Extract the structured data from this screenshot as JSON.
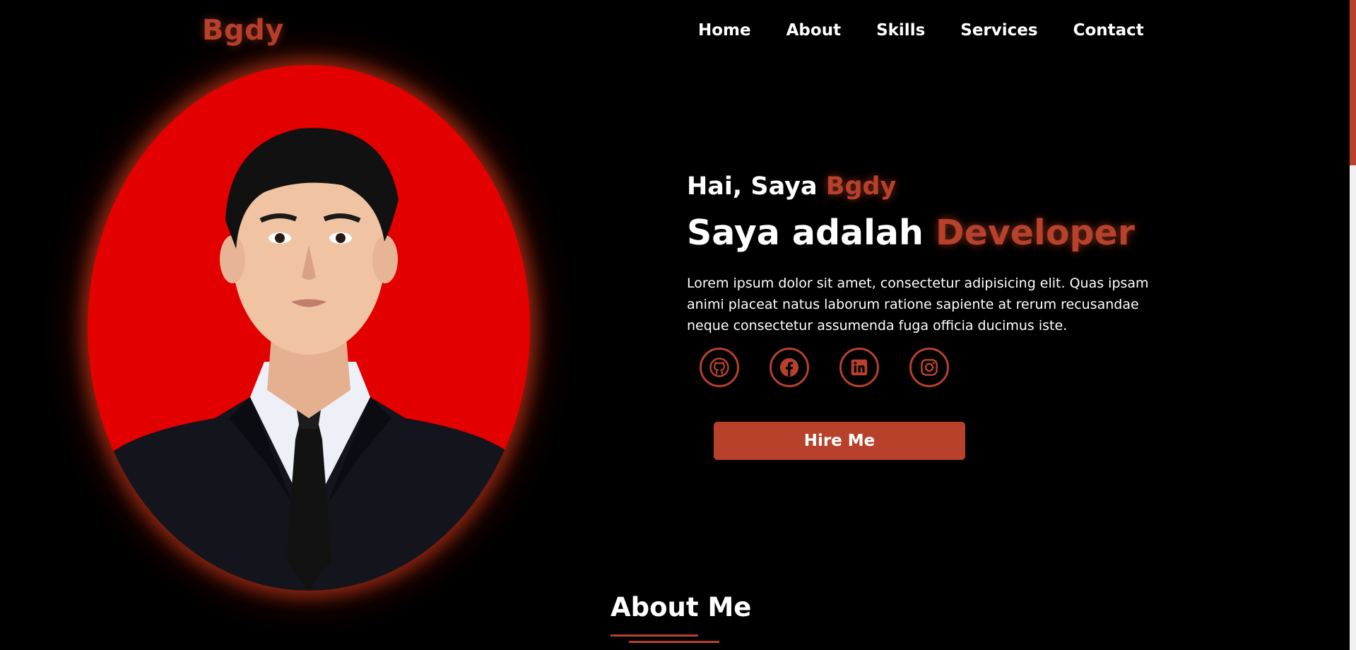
{
  "logo": "Bgdy",
  "nav": {
    "items": [
      "Home",
      "About",
      "Skills",
      "Services",
      "Contact"
    ]
  },
  "hero": {
    "greeting_prefix": "Hai, Saya ",
    "greeting_name": "Bgdy",
    "title_prefix": "Saya adalah ",
    "title_role": "Developer",
    "description": "Lorem ipsum dolor sit amet, consectetur adipisicing elit. Quas ipsam animi placeat natus laborum ratione sapiente at rerum recusandae neque consectetur assumenda fuga officia ducimus iste.",
    "hire_label": "Hire Me"
  },
  "socials": [
    {
      "icon": "github-icon"
    },
    {
      "icon": "facebook-icon"
    },
    {
      "icon": "linkedin-icon"
    },
    {
      "icon": "instagram-icon"
    }
  ],
  "about": {
    "title": "About Me"
  },
  "colors": {
    "accent": "#b7412b",
    "photo_background": "#e20000",
    "page_background": "#000000"
  }
}
